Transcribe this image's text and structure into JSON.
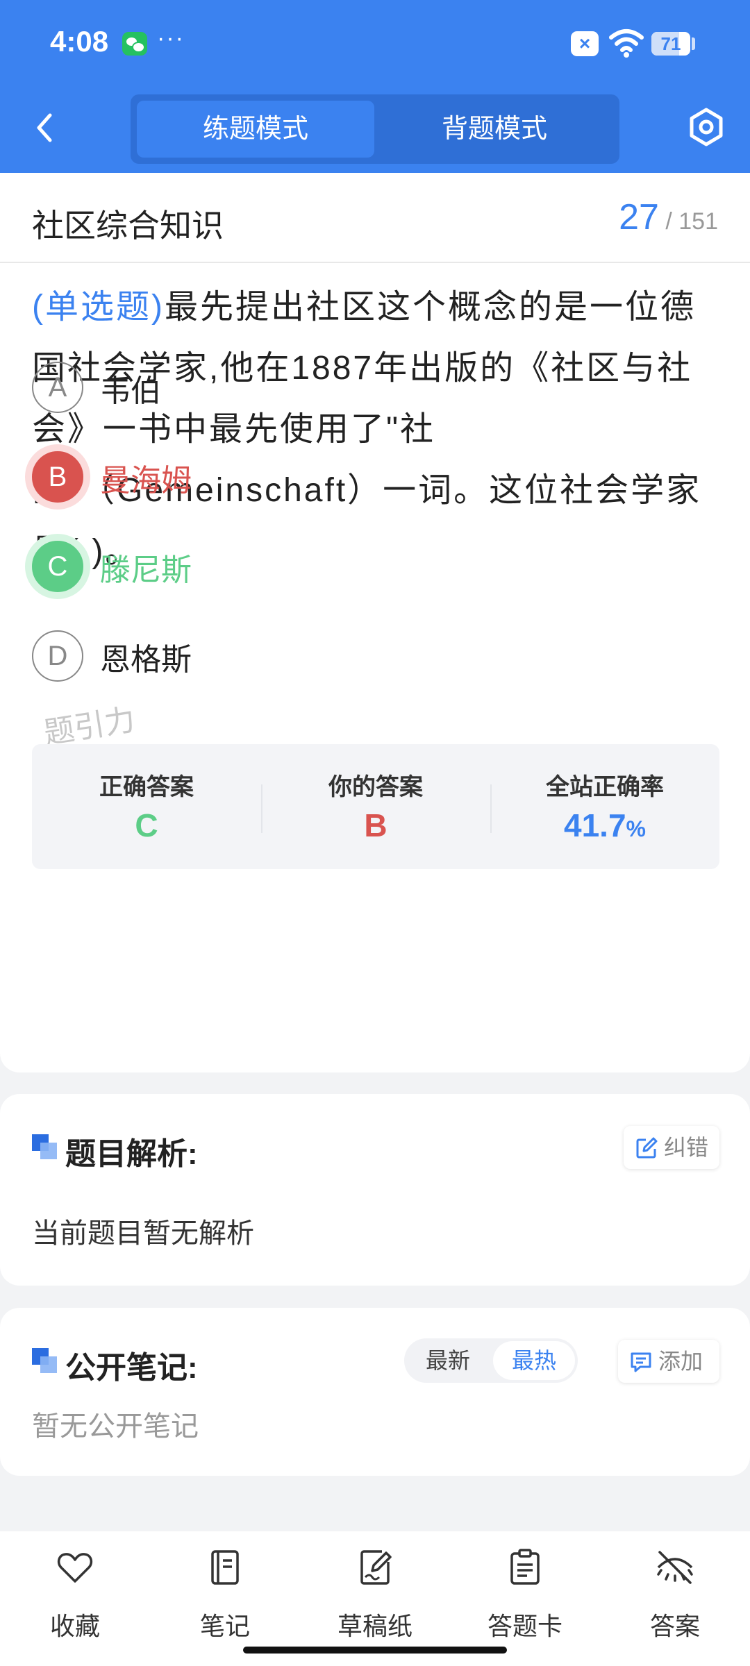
{
  "status_bar": {
    "time": "4:08",
    "battery": "71",
    "battery_level": 0.71
  },
  "header": {
    "tabs": [
      {
        "label": "练题模式",
        "active": true
      },
      {
        "label": "背题模式",
        "active": false
      }
    ]
  },
  "question": {
    "subject": "社区综合知识",
    "current": "27",
    "total": "/ 151",
    "type_tag": "(单选题)",
    "text": "最先提出社区这个概念的是一位德国社会学家,他在1887年出版的《社区与社会》一书中最先使用了\"社区\"（Gemeinschaft）一词。这位社会学家是(        )。",
    "options": [
      {
        "letter": "A",
        "text": "韦伯",
        "state": "normal"
      },
      {
        "letter": "B",
        "text": "曼海姆",
        "state": "wrong"
      },
      {
        "letter": "C",
        "text": "滕尼斯",
        "state": "correct"
      },
      {
        "letter": "D",
        "text": "恩格斯",
        "state": "normal"
      }
    ],
    "watermark": "题引力"
  },
  "result": {
    "correct_label": "正确答案",
    "correct_value": "C",
    "yours_label": "你的答案",
    "yours_value": "B",
    "rate_label": "全站正确率",
    "rate_value": "41.7",
    "rate_unit": "%"
  },
  "analysis": {
    "title": "题目解析:",
    "report_label": "纠错",
    "content": "当前题目暂无解析"
  },
  "notes": {
    "title": "公开笔记:",
    "sort_options": [
      "最新",
      "最热"
    ],
    "active_sort": "最热",
    "add_label": "添加",
    "empty_text": "暂无公开笔记"
  },
  "bottom_nav": [
    {
      "label": "收藏",
      "icon": "heart-icon"
    },
    {
      "label": "笔记",
      "icon": "notebook-icon"
    },
    {
      "label": "草稿纸",
      "icon": "draft-icon"
    },
    {
      "label": "答题卡",
      "icon": "answer-sheet-icon"
    },
    {
      "label": "答案",
      "icon": "eye-off-icon"
    }
  ],
  "colors": {
    "primary": "#3b82f0",
    "correct": "#5ccd87",
    "wrong": "#d9534f"
  }
}
